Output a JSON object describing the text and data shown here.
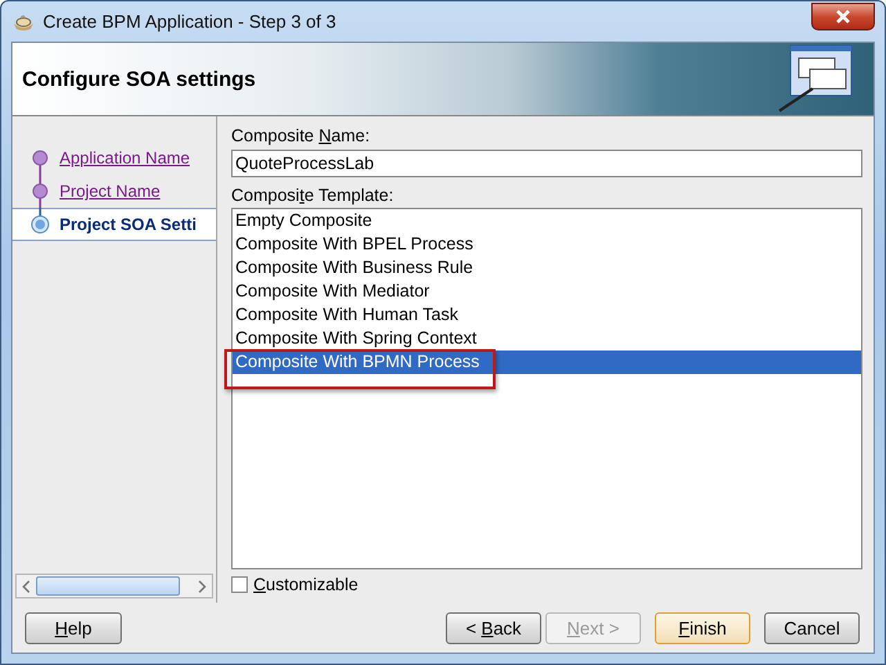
{
  "window": {
    "title": "Create BPM Application - Step 3 of 3"
  },
  "header": {
    "title": "Configure SOA settings"
  },
  "steps": [
    {
      "label": "Application Name",
      "selected": false,
      "visited": true
    },
    {
      "label": "Project Name",
      "selected": false,
      "visited": true
    },
    {
      "label": "Project SOA Setti",
      "selected": true,
      "visited": false
    }
  ],
  "composite_name": {
    "label": {
      "before": "Composite ",
      "key": "N",
      "after": "ame:"
    },
    "value": "QuoteProcessLab"
  },
  "composite_template": {
    "label": {
      "before": "Composi",
      "key": "t",
      "after": "e Template:"
    },
    "items": [
      {
        "label": "Empty Composite",
        "selected": false
      },
      {
        "label": "Composite With BPEL Process",
        "selected": false
      },
      {
        "label": "Composite With Business Rule",
        "selected": false
      },
      {
        "label": "Composite With Mediator",
        "selected": false
      },
      {
        "label": "Composite With Human Task",
        "selected": false
      },
      {
        "label": "Composite With Spring Context",
        "selected": false
      },
      {
        "label": "Composite With BPMN Process",
        "selected": true,
        "highlighted": true
      }
    ]
  },
  "customizable": {
    "label": {
      "key": "C",
      "after": "ustomizable"
    },
    "checked": false
  },
  "buttons": [
    {
      "kind": "help",
      "label": {
        "key": "H",
        "after": "elp"
      },
      "disabled": false
    },
    {
      "kind": "nav",
      "label": {
        "before": "< ",
        "key": "B",
        "after": "ack"
      },
      "disabled": false
    },
    {
      "kind": "nav",
      "label": {
        "key": "N",
        "after": "ext >"
      },
      "disabled": true
    },
    {
      "kind": "default",
      "label": {
        "key": "F",
        "after": "inish"
      },
      "disabled": false
    },
    {
      "kind": "nav",
      "label": {
        "before": "Cancel"
      },
      "disabled": false
    }
  ]
}
